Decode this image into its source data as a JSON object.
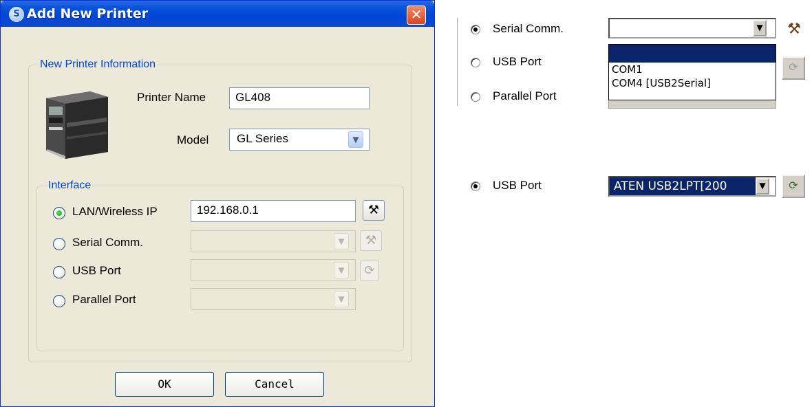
{
  "dialog": {
    "title": "Add New Printer",
    "close_glyph": "✕",
    "group_title": "New Printer Information",
    "printer_name_label": "Printer Name",
    "printer_name_value": "GL408",
    "model_label": "Model",
    "model_value": "GL Series",
    "interface": {
      "group_title": "Interface",
      "options": [
        {
          "label": "LAN/Wireless IP",
          "selected": true
        },
        {
          "label": "Serial Comm.",
          "selected": false
        },
        {
          "label": "USB Port",
          "selected": false
        },
        {
          "label": "Parallel Port",
          "selected": false
        }
      ],
      "ip_value": "192.168.0.1"
    },
    "ok_label": "OK",
    "cancel_label": "Cancel"
  },
  "serial_panel": {
    "options": [
      {
        "label": "Serial Comm.",
        "selected": true
      },
      {
        "label": "USB Port",
        "selected": false
      },
      {
        "label": "Parallel Port",
        "selected": false
      }
    ],
    "dropdown_items": [
      "",
      "COM1",
      "COM4 [USB2Serial]"
    ],
    "highlighted_item": 0
  },
  "usb_panel": {
    "label": "USB Port",
    "selected": true,
    "value": "ATEN USB2LPT[200"
  },
  "icons": [
    "settings-tools-icon",
    "refresh-icon",
    "dropdown-arrow-icon",
    "printer-image"
  ],
  "colors": {
    "title_bar": "#0046d5",
    "group_title": "#0046d5",
    "selection": "#0a246a"
  }
}
